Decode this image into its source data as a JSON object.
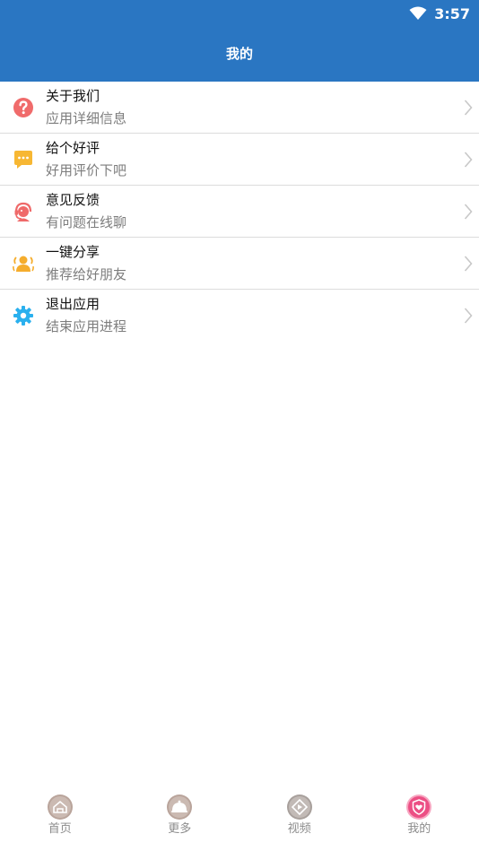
{
  "status_bar": {
    "time": "3:57",
    "wifi_icon": "wifi-icon"
  },
  "header": {
    "title": "我的",
    "color": "#2a76c2"
  },
  "menu": {
    "items": [
      {
        "title": "关于我们",
        "subtitle": "应用详细信息",
        "icon": "question-icon",
        "icon_color": "#f06b6b"
      },
      {
        "title": "给个好评",
        "subtitle": "好用评价下吧",
        "icon": "chat-bubble-icon",
        "icon_color": "#f7b733"
      },
      {
        "title": "意见反馈",
        "subtitle": "有问题在线聊",
        "icon": "support-agent-icon",
        "icon_color": "#ef6a6a"
      },
      {
        "title": "一键分享",
        "subtitle": "推荐给好朋友",
        "icon": "share-users-icon",
        "icon_color": "#f5ad2d"
      },
      {
        "title": "退出应用",
        "subtitle": "结束应用进程",
        "icon": "gear-icon",
        "icon_color": "#2ab0ee"
      }
    ]
  },
  "tabbar": {
    "tabs": [
      {
        "label": "首页",
        "icon": "home-icon",
        "active": false
      },
      {
        "label": "更多",
        "icon": "bell-dish-icon",
        "active": false
      },
      {
        "label": "视频",
        "icon": "video-icon",
        "active": false
      },
      {
        "label": "我的",
        "icon": "shield-heart-icon",
        "active": true
      }
    ],
    "active_color": "#ec4f84"
  }
}
